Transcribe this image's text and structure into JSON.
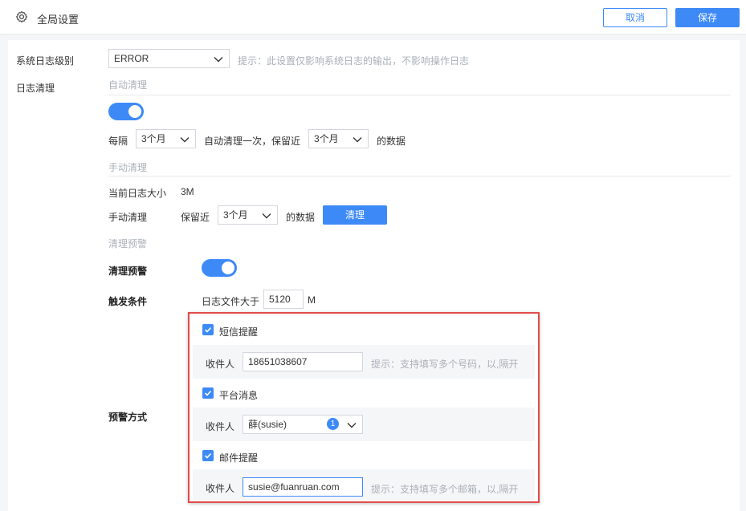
{
  "header": {
    "title": "全局设置",
    "cancel_label": "取消",
    "save_label": "保存"
  },
  "log_level": {
    "label": "系统日志级别",
    "value": "ERROR",
    "hint": "提示：此设置仅影响系统日志的输出，不影响操作日志"
  },
  "log_cleanup": {
    "label": "日志清理",
    "auto": {
      "section_title": "自动清理",
      "enabled": true,
      "every_label": "每隔",
      "interval_value": "3个月",
      "middle_text": "自动清理一次，保留近",
      "keep_value": "3个月",
      "suffix_text": "的数据"
    },
    "manual": {
      "section_title": "手动清理",
      "current_size_label": "当前日志大小",
      "current_size_value": "3M",
      "manual_label": "手动清理",
      "keep_label": "保留近",
      "keep_value": "3个月",
      "suffix_text": "的数据",
      "clean_button": "清理"
    },
    "warning": {
      "section_title": "清理预警",
      "toggle_label": "清理预警",
      "enabled": true,
      "trigger_label": "触发条件",
      "trigger_text": "日志文件大于",
      "trigger_value": "5120",
      "trigger_unit": "M",
      "method_label": "预警方式",
      "sms": {
        "label": "短信提醒",
        "checked": true,
        "recipient_label": "收件人",
        "recipient_value": "18651038607",
        "hint": "提示：支持填写多个号码，以,隔开"
      },
      "platform": {
        "label": "平台消息",
        "checked": true,
        "recipient_label": "收件人",
        "recipient_value": "薛(susie)",
        "badge": "1"
      },
      "email": {
        "label": "邮件提醒",
        "checked": true,
        "recipient_label": "收件人",
        "recipient_value": "susie@fuanruan.com",
        "hint": "提示：支持填写多个邮箱，以,隔开"
      }
    }
  },
  "colors": {
    "primary": "#3d8af7",
    "alert_border": "#e14b4b"
  }
}
